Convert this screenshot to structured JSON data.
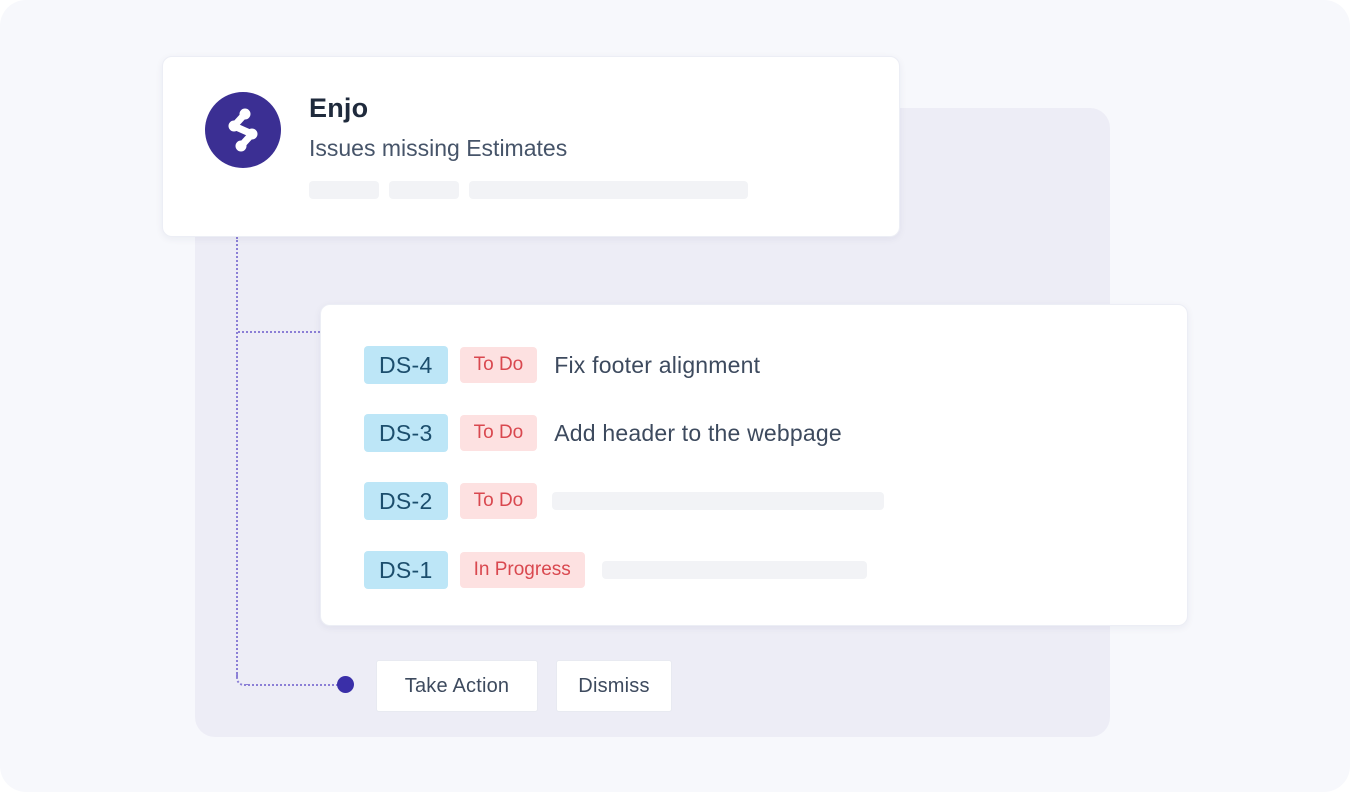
{
  "bot": {
    "name": "Enjo",
    "subtitle": "Issues missing Estimates",
    "avatar_color": "#3b2f93",
    "avatar_icon": "enjo-logo-icon"
  },
  "issues": [
    {
      "key": "DS-4",
      "status": "To Do",
      "title": "Fix footer alignment"
    },
    {
      "key": "DS-3",
      "status": "To Do",
      "title": "Add header to the webpage"
    },
    {
      "key": "DS-2",
      "status": "To Do",
      "title": ""
    },
    {
      "key": "DS-1",
      "status": "In Progress",
      "title": ""
    }
  ],
  "actions": {
    "take_action_label": "Take Action",
    "dismiss_label": "Dismiss"
  },
  "colors": {
    "accent": "#3a2fa8",
    "key_badge_bg": "#bde6f7",
    "status_badge_bg": "#fde1e1",
    "status_text": "#d9484f"
  }
}
